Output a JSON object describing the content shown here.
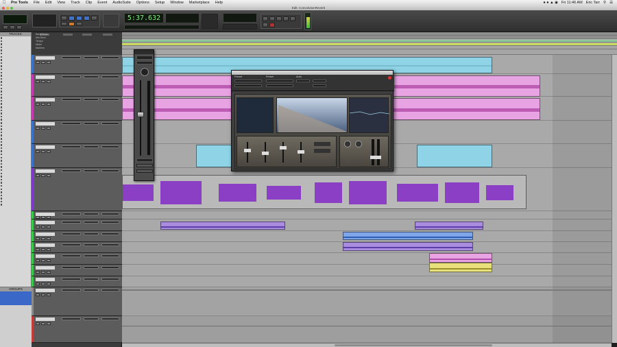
{
  "menubar": {
    "app": "Pro Tools",
    "items": [
      "File",
      "Edit",
      "View",
      "Track",
      "Clip",
      "Event",
      "AudioSuite",
      "Options",
      "Setup",
      "Window",
      "Marketplace",
      "Help"
    ],
    "clock": "Fri 11:46 AM",
    "user": "Eric Tarr"
  },
  "window": {
    "title": "Edit: ConvolutionReverb"
  },
  "transport": {
    "main_counter": "5:37.632",
    "mini_counter": "",
    "accent": "#7df27d"
  },
  "tracklist": {
    "header": "TRACKS",
    "items": [
      "",
      "",
      "",
      "",
      "",
      "",
      "",
      "",
      "",
      "",
      "",
      "",
      "",
      "",
      "",
      "",
      "",
      "",
      "",
      "",
      "",
      "",
      "",
      "",
      "",
      "",
      "",
      "",
      "",
      "",
      "",
      "",
      "",
      "",
      "",
      "",
      "",
      "",
      "",
      "",
      "",
      "",
      "",
      "",
      "",
      "",
      "",
      "",
      "",
      "",
      "",
      "",
      "",
      ""
    ]
  },
  "groups": {
    "header": "GROUPS",
    "items": [
      {
        "label": "",
        "selected": true
      },
      {
        "label": "",
        "selected": true
      },
      {
        "label": "",
        "selected": true
      },
      {
        "label": "",
        "selected": true
      },
      {
        "label": "",
        "selected": false
      }
    ]
  },
  "rulers": [
    "Bars|Beats",
    "Min:Secs",
    "Tempo",
    "Meter",
    "Markers"
  ],
  "plugin": {
    "header_labels": [
      "Preset",
      "Preset",
      "Auto"
    ],
    "field_values": [
      "",
      "",
      ""
    ],
    "extra": [
      "",
      ""
    ]
  },
  "clips_colors": {
    "cyan": "#8fd3e6",
    "pink": "#e59be0",
    "purple": "#8b5fc6",
    "lavender": "#a98be0",
    "blue": "#7ea6e8",
    "yellow": "#e8e07a"
  }
}
